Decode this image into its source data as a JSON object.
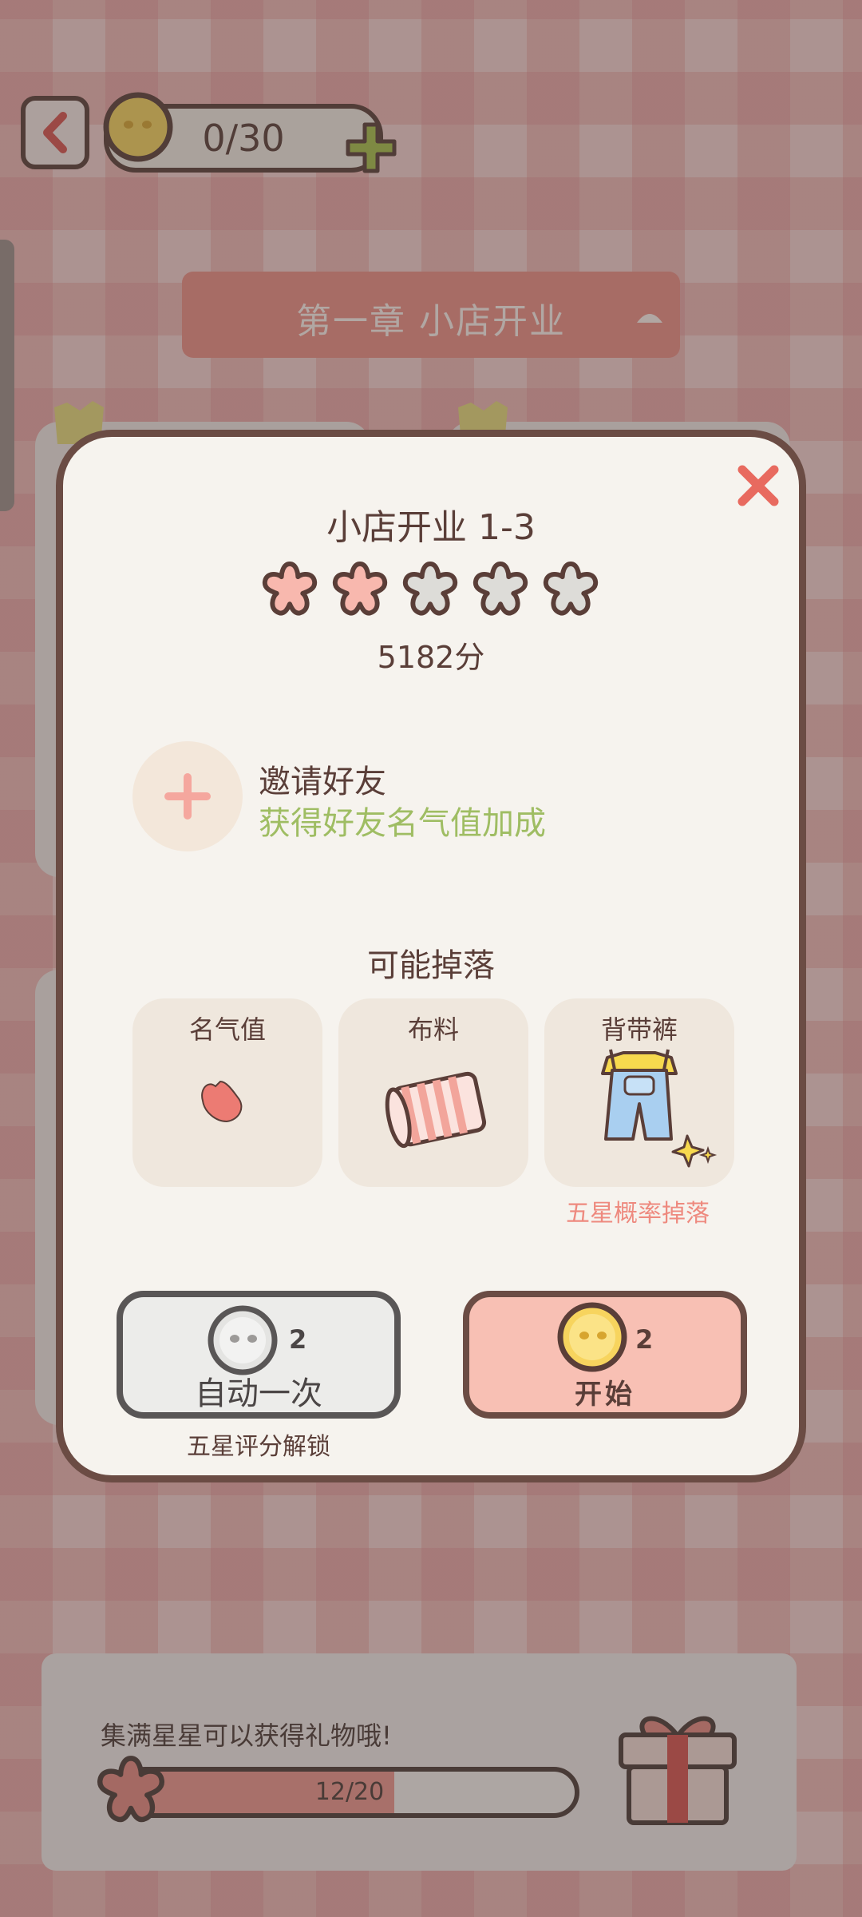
{
  "header": {
    "coin_count": "0/30",
    "chapter_title": "第一章  小店开业"
  },
  "stage": {
    "title": "小店开业 1-3",
    "stars_earned": 2,
    "stars_total": 5,
    "score": "5182分"
  },
  "invite": {
    "title": "邀请好友",
    "subtitle": "获得好友名气值加成"
  },
  "drops": {
    "heading": "可能掉落",
    "items": [
      {
        "label": "名气值",
        "icon": "heart-petal-icon"
      },
      {
        "label": "布料",
        "icon": "fabric-roll-icon"
      },
      {
        "label": "背带裤",
        "icon": "overalls-icon"
      }
    ],
    "note": "五星概率掉落"
  },
  "actions": {
    "auto": {
      "cost": "2",
      "label": "自动一次",
      "hint": "五星评分解锁"
    },
    "start": {
      "cost": "2",
      "label": "开始"
    }
  },
  "gift": {
    "text": "集满星星可以获得礼物哦!",
    "progress_label": "12/20",
    "progress_current": 12,
    "progress_total": 20
  },
  "colors": {
    "accent": "#ee8f86",
    "star_filled": "#f8b8ae",
    "star_empty": "#dddcd8",
    "outline": "#5a3e38",
    "green": "#9fbd63"
  }
}
